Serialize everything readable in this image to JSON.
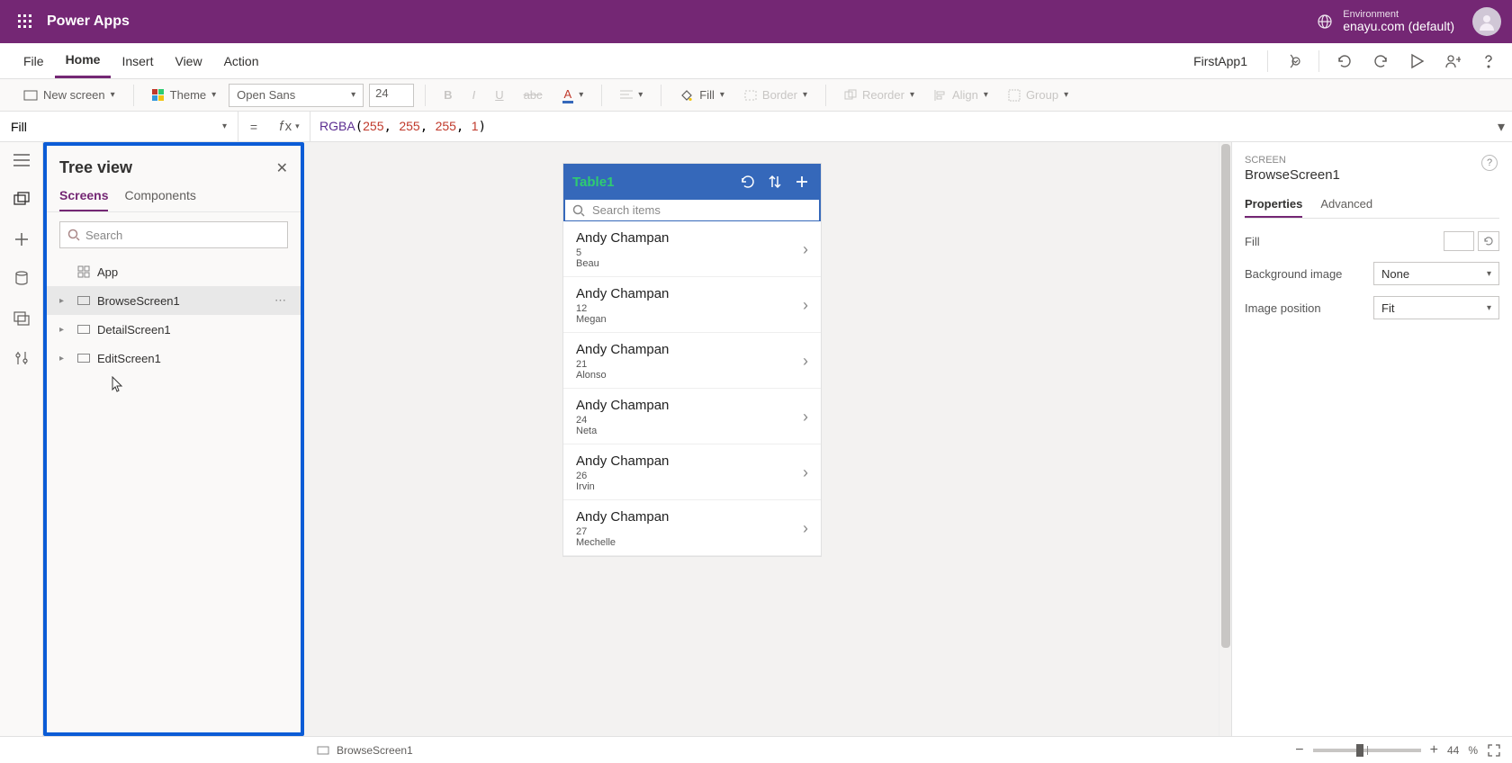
{
  "header": {
    "app_title": "Power Apps",
    "env_label": "Environment",
    "env_name": "enayu.com (default)"
  },
  "menubar": {
    "items": [
      "File",
      "Home",
      "Insert",
      "View",
      "Action"
    ],
    "active_index": 1,
    "doc_name": "FirstApp1"
  },
  "ribbon": {
    "new_screen": "New screen",
    "theme": "Theme",
    "font": "Open Sans",
    "font_size": "24",
    "fill": "Fill",
    "border": "Border",
    "reorder": "Reorder",
    "align": "Align",
    "group": "Group"
  },
  "formula": {
    "property": "Fill",
    "fn": "RGBA",
    "args": [
      "255",
      "255",
      "255",
      "1"
    ]
  },
  "tree": {
    "title": "Tree view",
    "tabs": [
      "Screens",
      "Components"
    ],
    "active_tab": 0,
    "search_placeholder": "Search",
    "app_row": "App",
    "items": [
      "BrowseScreen1",
      "DetailScreen1",
      "EditScreen1"
    ],
    "selected_index": 0
  },
  "phone": {
    "title": "Table1",
    "search_placeholder": "Search items",
    "records": [
      {
        "name": "Andy Champan",
        "num": "5",
        "sub": "Beau"
      },
      {
        "name": "Andy Champan",
        "num": "12",
        "sub": "Megan"
      },
      {
        "name": "Andy Champan",
        "num": "21",
        "sub": "Alonso"
      },
      {
        "name": "Andy Champan",
        "num": "24",
        "sub": "Neta"
      },
      {
        "name": "Andy Champan",
        "num": "26",
        "sub": "Irvin"
      },
      {
        "name": "Andy Champan",
        "num": "27",
        "sub": "Mechelle"
      }
    ]
  },
  "props": {
    "category": "SCREEN",
    "screen_name": "BrowseScreen1",
    "tabs": [
      "Properties",
      "Advanced"
    ],
    "active_tab": 0,
    "rows": {
      "fill_label": "Fill",
      "bg_label": "Background image",
      "bg_value": "None",
      "imgpos_label": "Image position",
      "imgpos_value": "Fit"
    }
  },
  "status": {
    "breadcrumb": "BrowseScreen1",
    "zoom": "44",
    "pct": "%"
  }
}
